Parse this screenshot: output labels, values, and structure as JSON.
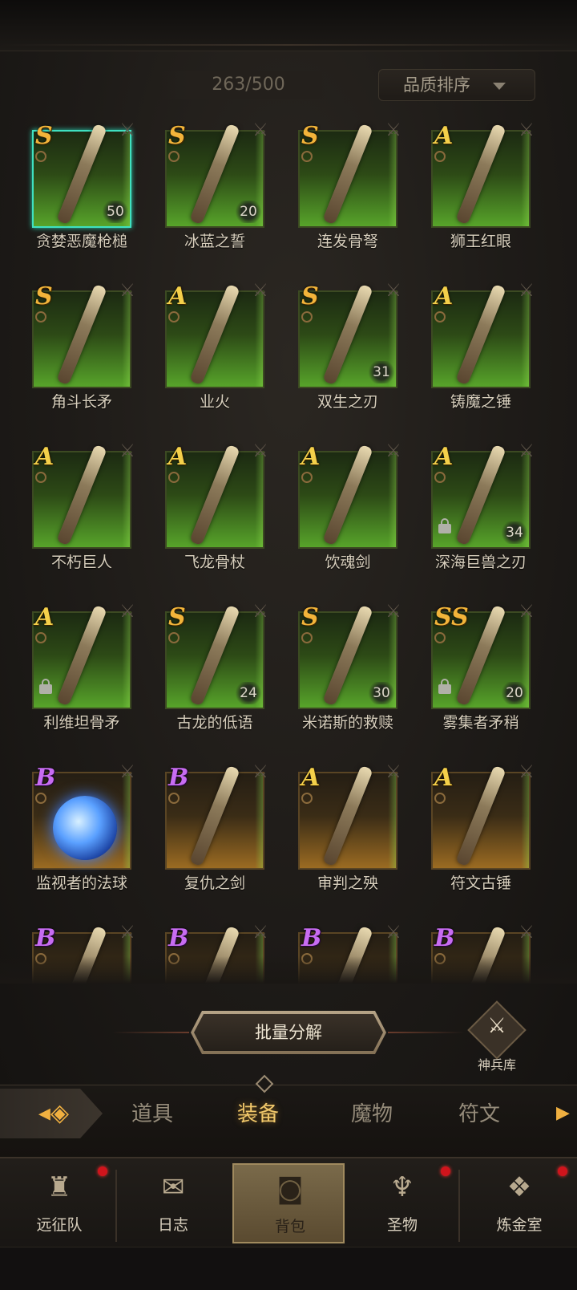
{
  "inventory": {
    "count": "263/500",
    "sort_label": "品质排序"
  },
  "items": [
    {
      "name": "贪婪恶魔枪槌",
      "grade": "S",
      "level": "50",
      "selected": true
    },
    {
      "name": "冰蓝之誓",
      "grade": "S",
      "level": "20"
    },
    {
      "name": "连发骨弩",
      "grade": "S",
      "level": ""
    },
    {
      "name": "狮王红眼",
      "grade": "A",
      "level": ""
    },
    {
      "name": "角斗长矛",
      "grade": "S",
      "level": ""
    },
    {
      "name": "业火",
      "grade": "A",
      "level": ""
    },
    {
      "name": "双生之刃",
      "grade": "S",
      "level": "31"
    },
    {
      "name": "铸魔之锤",
      "grade": "A",
      "level": ""
    },
    {
      "name": "不朽巨人",
      "grade": "A",
      "level": ""
    },
    {
      "name": "飞龙骨杖",
      "grade": "A",
      "level": ""
    },
    {
      "name": "饮魂剑",
      "grade": "A",
      "level": ""
    },
    {
      "name": "深海巨兽之刃",
      "grade": "A",
      "level": "34",
      "locked": true
    },
    {
      "name": "利维坦骨矛",
      "grade": "A",
      "level": "",
      "locked": true
    },
    {
      "name": "古龙的低语",
      "grade": "S",
      "level": "24"
    },
    {
      "name": "米诺斯的救赎",
      "grade": "S",
      "level": "30"
    },
    {
      "name": "雾集者矛稍",
      "grade": "SS",
      "level": "20",
      "locked": true
    },
    {
      "name": "监视者的法球",
      "grade": "B",
      "level": ""
    },
    {
      "name": "复仇之剑",
      "grade": "B",
      "level": ""
    },
    {
      "name": "审判之殃",
      "grade": "A",
      "level": ""
    },
    {
      "name": "符文古锤",
      "grade": "A",
      "level": ""
    },
    {
      "name": "",
      "grade": "B",
      "level": ""
    },
    {
      "name": "",
      "grade": "B",
      "level": ""
    },
    {
      "name": "",
      "grade": "B",
      "level": ""
    },
    {
      "name": "",
      "grade": "B",
      "level": ""
    }
  ],
  "actions": {
    "bulk_decompose": "批量分解",
    "armory": "神兵库"
  },
  "tabs": [
    {
      "label": "道具"
    },
    {
      "label": "装备",
      "active": true
    },
    {
      "label": "魔物"
    },
    {
      "label": "符文"
    }
  ],
  "nav": [
    {
      "label": "远征队",
      "icon": "viking-helmet-icon",
      "badge": true
    },
    {
      "label": "日志",
      "icon": "scroll-icon",
      "badge": false
    },
    {
      "label": "背包",
      "icon": "backpack-icon",
      "badge": false,
      "active": true
    },
    {
      "label": "圣物",
      "icon": "chalice-icon",
      "badge": true
    },
    {
      "label": "炼金室",
      "icon": "alchemy-icon",
      "badge": true
    }
  ],
  "colors": {
    "grade_S": "#f2b43a",
    "grade_A": "#f4d04a",
    "grade_B": "#c86cf2",
    "card_green": "#57a42a",
    "card_gold": "#9b6b22",
    "badge_red": "#d0141c"
  }
}
